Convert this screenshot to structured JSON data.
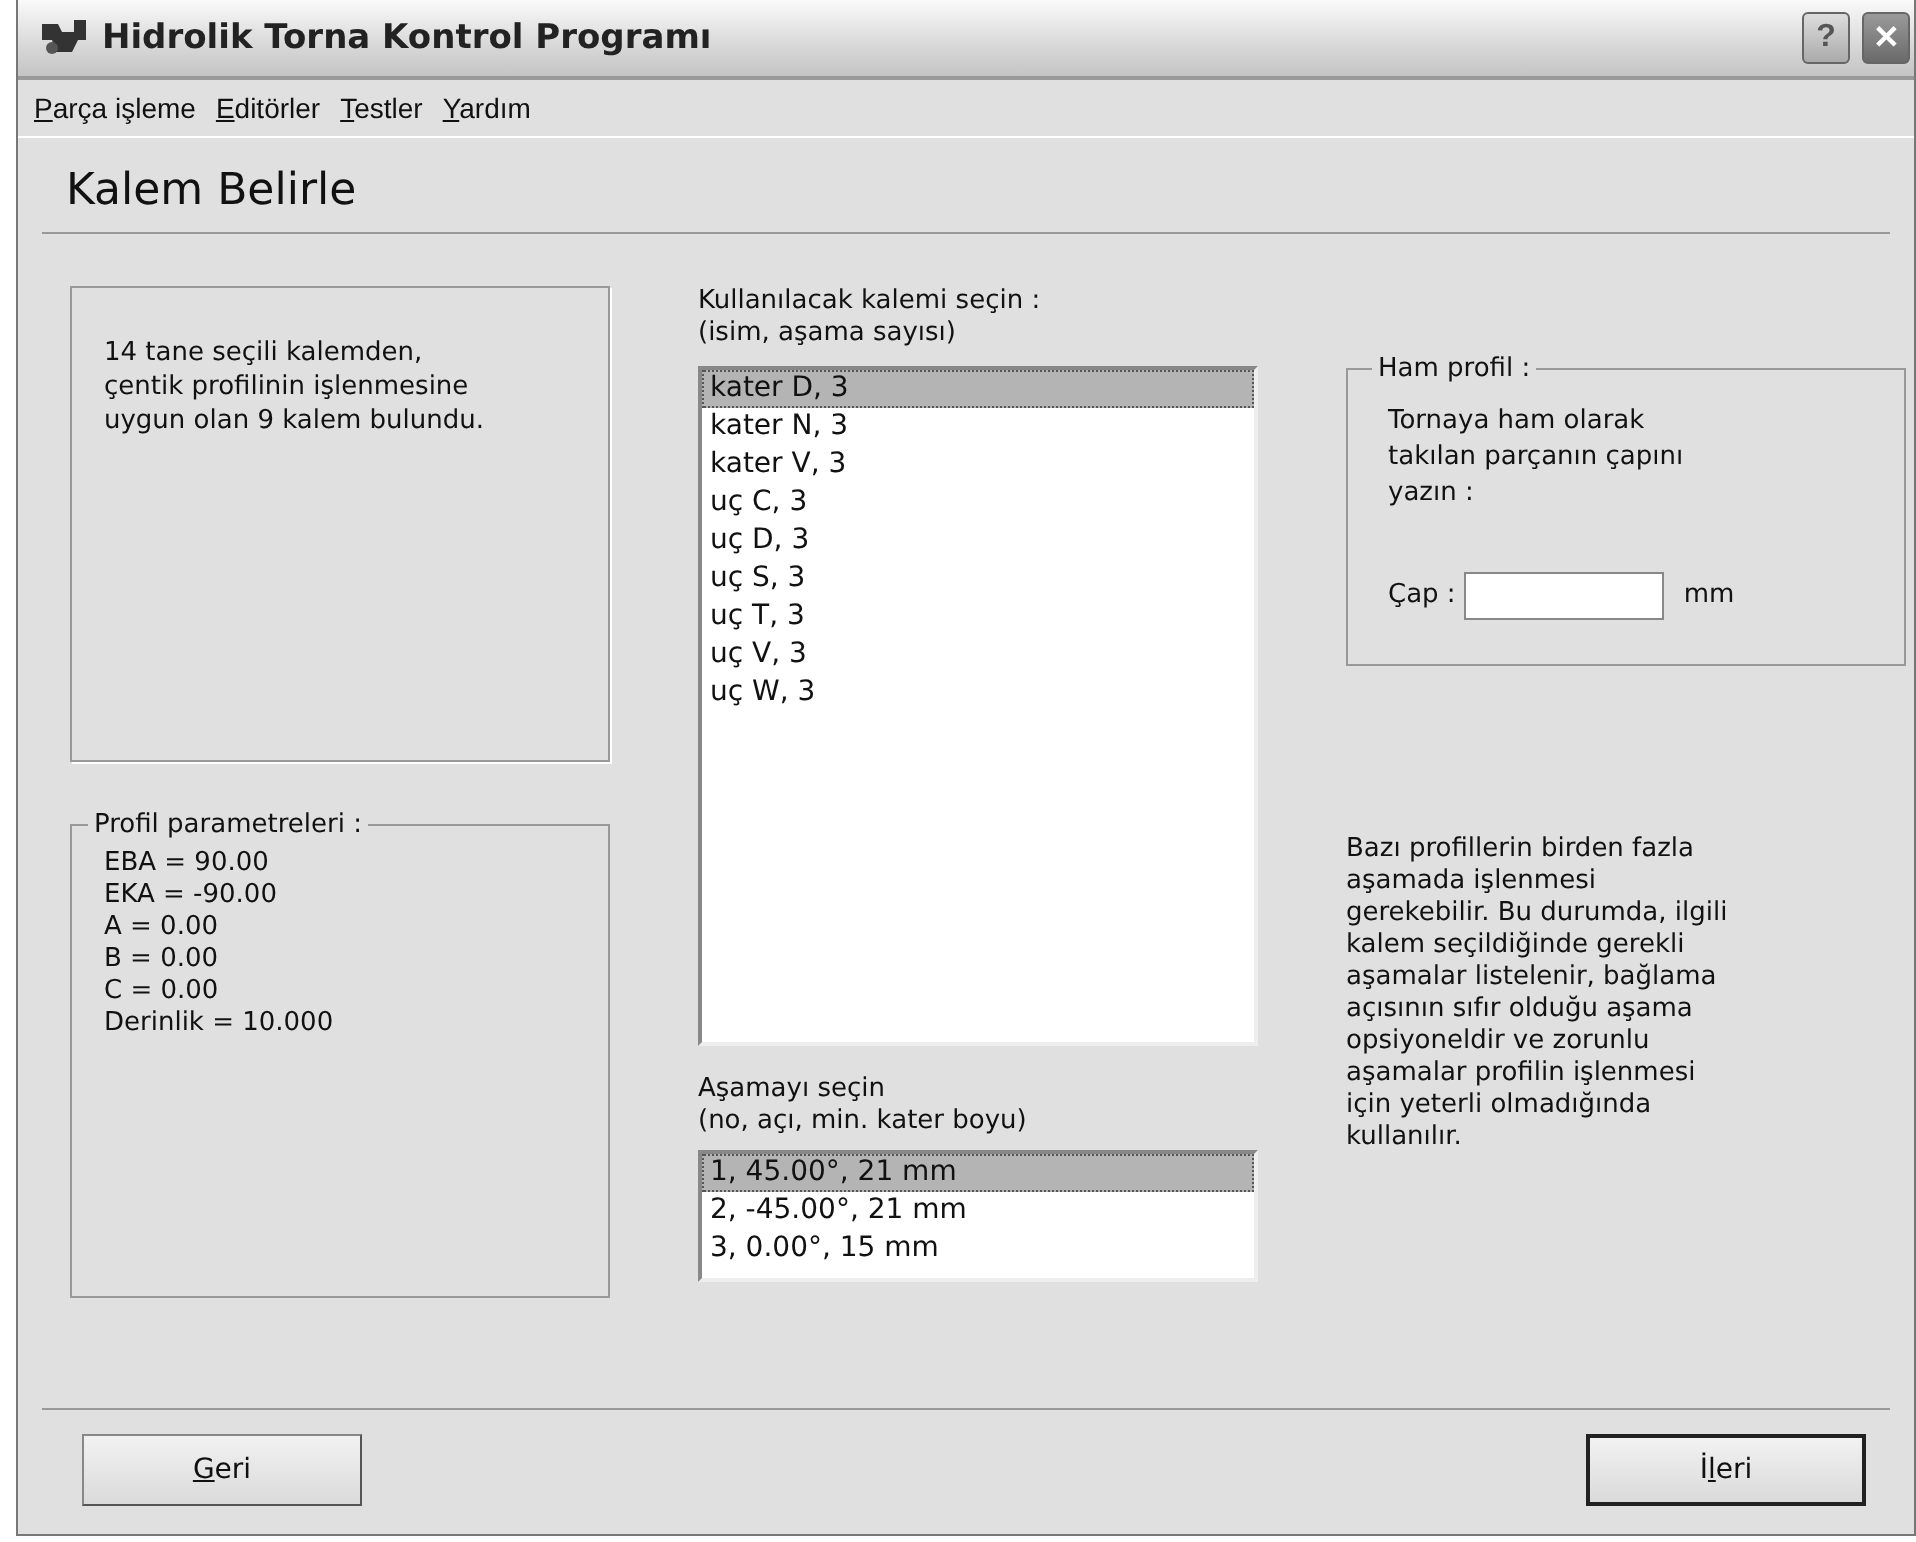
{
  "window": {
    "title": "Hidrolik Torna Kontrol Programı",
    "buttons": [
      {
        "kind": "help",
        "label": "?"
      },
      {
        "kind": "close",
        "label": "✕"
      }
    ]
  },
  "menu": [
    {
      "label": "Parça işleme"
    },
    {
      "label": "Editörler"
    },
    {
      "label": "Testler"
    },
    {
      "label": "Yardım"
    }
  ],
  "heading": "Kalem Belirle",
  "info": "14 tane seçili kalemden, çentik profilinin işlenmesine uygun olan 9 kalem bulundu.",
  "profile_params": {
    "title": "Profil parametreleri :",
    "lines": [
      "EBA = 90.00",
      "EKA = -90.00",
      "A = 0.00",
      "B = 0.00",
      "C = 0.00",
      "Derinlik = 10.000"
    ]
  },
  "tool_list": {
    "label": "Kullanılacak kalemi seçin :",
    "sublabel": "(isim, aşama sayısı)",
    "items": [
      {
        "text": "kater D, 3",
        "selected": true
      },
      {
        "text": "kater N, 3",
        "selected": false
      },
      {
        "text": "kater V, 3",
        "selected": false
      },
      {
        "text": "uç C, 3",
        "selected": false
      },
      {
        "text": "uç D, 3",
        "selected": false
      },
      {
        "text": "uç S, 3",
        "selected": false
      },
      {
        "text": "uç T, 3",
        "selected": false
      },
      {
        "text": "uç V, 3",
        "selected": false
      },
      {
        "text": "uç W, 3",
        "selected": false
      }
    ]
  },
  "stage_list": {
    "label": "Aşamayı seçin",
    "sublabel": "(no, açı, min. kater boyu)",
    "items": [
      {
        "text": "1, 45.00°, 21 mm",
        "selected": true
      },
      {
        "text": "2, -45.00°, 21 mm",
        "selected": false
      },
      {
        "text": "3, 0.00°, 15 mm",
        "selected": false
      }
    ]
  },
  "raw_profile": {
    "title": "Ham profil :",
    "description": "Tornaya ham olarak takılan parçanın çapını yazın :",
    "field_label": "Çap :",
    "unit": "mm"
  },
  "help_text": "Bazı profillerin birden fazla aşamada işlenmesi gerekebilir. Bu durumda, ilgili kalem seçildiğinde gerekli aşamalar listelenir, bağlama açısının sıfır olduğu aşama opsiyoneldir ve zorunlu aşamalar profilin işlenmesi için yeterli olmadığında kullanılır.",
  "footer": {
    "back": {
      "label": "Geri"
    },
    "next": {
      "label": "İleri"
    }
  }
}
